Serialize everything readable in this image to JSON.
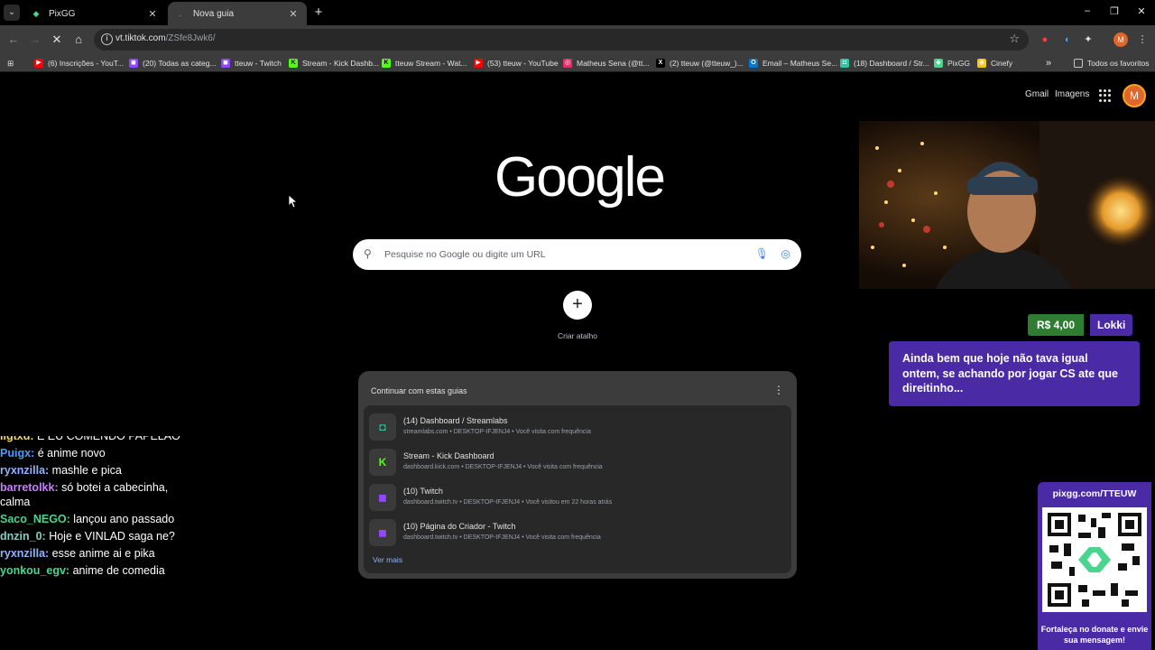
{
  "tabs": {
    "menu_icon": "chevron-down",
    "inactive": {
      "title": "PixGG",
      "close": "✕"
    },
    "active": {
      "title": "Nova guia",
      "close": "✕"
    },
    "new_tab": "+"
  },
  "window_controls": {
    "minimize": "–",
    "restore": "❐",
    "close": "✕"
  },
  "toolbar": {
    "url_host": "vt.tiktok.com",
    "url_path": "/ZSfe8Jwk6/"
  },
  "bookmarks": [
    {
      "label": "(6) Inscrições - YouT...",
      "icon": "youtube-icon",
      "color": "#ff0000"
    },
    {
      "label": "(20) Todas as categ...",
      "icon": "twitch-icon",
      "color": "#9146ff"
    },
    {
      "label": "tteuw - Twitch",
      "icon": "twitch-icon",
      "color": "#9146ff"
    },
    {
      "label": "Stream - Kick Dashb...",
      "icon": "kick-icon",
      "color": "#53fc18"
    },
    {
      "label": "tteuw Stream - Wat...",
      "icon": "kick-icon",
      "color": "#53fc18"
    },
    {
      "label": "(53) tteuw - YouTube",
      "icon": "youtube-icon",
      "color": "#ff0000"
    },
    {
      "label": "Matheus Sena (@tt...",
      "icon": "instagram-icon",
      "color": "#e1306c"
    },
    {
      "label": "(2) tteuw (@tteuw_)...",
      "icon": "x-icon",
      "color": "#000000"
    },
    {
      "label": "Email – Matheus Se...",
      "icon": "outlook-icon",
      "color": "#0078d4"
    },
    {
      "label": "(18) Dashboard / Str...",
      "icon": "streamlabs-icon",
      "color": "#31c3a2"
    },
    {
      "label": "PixGG",
      "icon": "pixgg-icon",
      "color": "#4ad58e"
    },
    {
      "label": "Cinefy",
      "icon": "cinefy-icon",
      "color": "#f5c518"
    }
  ],
  "bookmarks_overflow": "»",
  "bookmarks_all": "Todos os favoritos",
  "google": {
    "gmail": "Gmail",
    "images": "Imagens",
    "avatar_letter": "M",
    "logo": "Google",
    "search_placeholder": "Pesquise no Google ou digite um URL",
    "shortcut_label": "Criar atalho",
    "continue_title": "Continuar com estas guias",
    "continue_rows": [
      {
        "title": "(14) Dashboard / Streamlabs",
        "sub": "streamlabs.com • DESKTOP-IFJENJ4 • Você visita com frequência",
        "icon": "streamlabs-icon"
      },
      {
        "title": "Stream - Kick Dashboard",
        "sub": "dashboard.kick.com • DESKTOP-IFJENJ4 • Você visita com frequência",
        "icon": "kick-icon"
      },
      {
        "title": "(10) Twitch",
        "sub": "dashboard.twitch.tv • DESKTOP-IFJENJ4 • Você visitou em 22 horas atrás",
        "icon": "twitch-icon"
      },
      {
        "title": "(10) Página do Criador - Twitch",
        "sub": "dashboard.twitch.tv • DESKTOP-IFJENJ4 • Você visita com frequência",
        "icon": "twitch-icon"
      }
    ],
    "see_more": "Ver mais"
  },
  "donation": {
    "amount": "R$ 4,00",
    "name": "Lokki",
    "message": "Ainda bem que hoje não tava igual ontem, se achando por jogar CS ate que direitinho..."
  },
  "chat": [
    {
      "user": "ligtxd:",
      "text": "E EU COMENDO PAPELÃO",
      "color": "#f5d76e"
    },
    {
      "user": "Puigx:",
      "text": "é anime novo",
      "color": "#4a9bff"
    },
    {
      "user": "ryxnzilla:",
      "text": "mashle e pica",
      "color": "#8fb3ff"
    },
    {
      "user": "barretolkk:",
      "text": "só botei a cabecinha, calma",
      "color": "#c77dff"
    },
    {
      "user": "Saco_NEGO:",
      "text": "lançou ano passado",
      "color": "#4ad58e"
    },
    {
      "user": "dnzin_0:",
      "text": "Hoje e VINLAD saga ne?",
      "color": "#7fd1c1"
    },
    {
      "user": "ryxnzilla:",
      "text": "esse anime ai e pika",
      "color": "#8fb3ff"
    },
    {
      "user": "yonkou_egv:",
      "text": "anime de comedia",
      "color": "#4ad58e"
    }
  ],
  "qr": {
    "title": "pixgg.com/TTEUW",
    "caption": "Fortaleça no donate e envie sua mensagem!"
  }
}
